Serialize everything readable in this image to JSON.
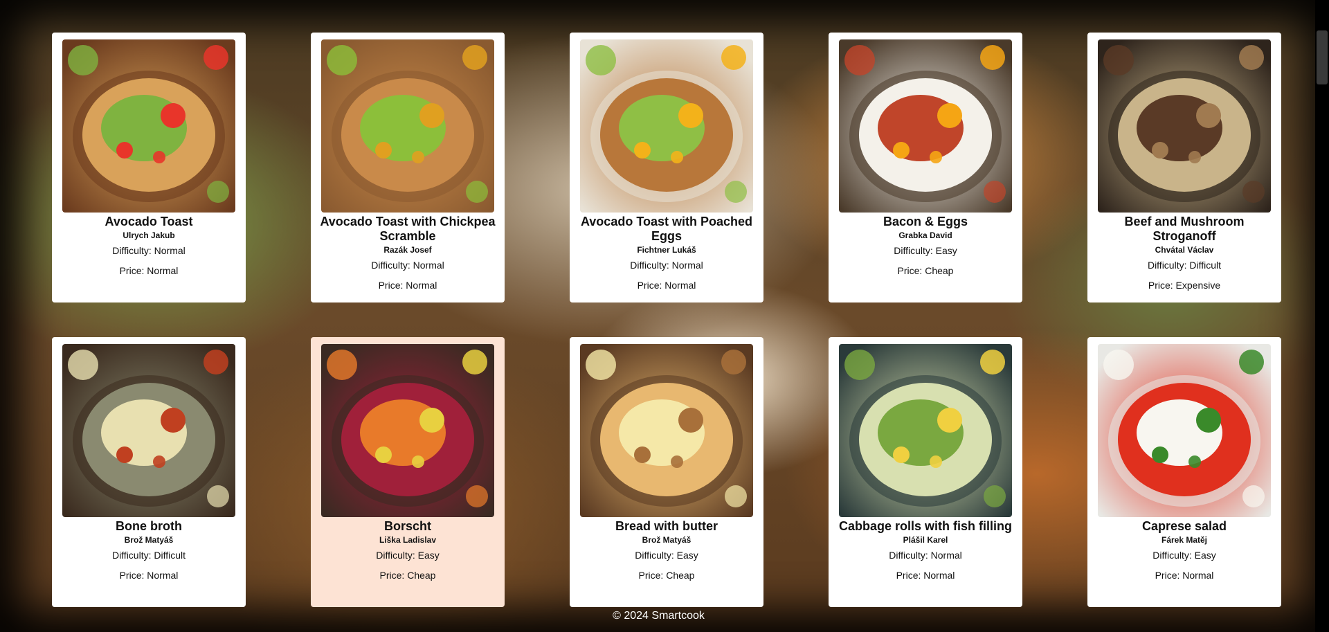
{
  "footer": {
    "copyright": "© 2024 Smartcook"
  },
  "labels": {
    "difficulty_prefix": "Difficulty: ",
    "price_prefix": "Price: "
  },
  "recipes": [
    {
      "title": "Avocado Toast",
      "author": "Ulrych Jakub",
      "difficulty": "Difficulty: Normal",
      "price": "Price: Normal",
      "image": "avocado-toast-image",
      "palette": [
        "#6b3b1e",
        "#d9a25a",
        "#7fb340",
        "#e8352a"
      ]
    },
    {
      "title": "Avocado Toast with Chickpea Scramble",
      "author": "Razák Josef",
      "difficulty": "Difficulty: Normal",
      "price": "Price: Normal",
      "image": "avocado-toast-chickpea-image",
      "palette": [
        "#8a5a30",
        "#c98a4a",
        "#8cbf3a",
        "#e0a020"
      ]
    },
    {
      "title": "Avocado Toast with Poached Eggs",
      "author": "Fichtner Lukáš",
      "difficulty": "Difficulty: Normal",
      "price": "Price: Normal",
      "image": "avocado-toast-poached-eggs-image",
      "palette": [
        "#e8e2d6",
        "#b8773a",
        "#8fbf45",
        "#f3b21a"
      ]
    },
    {
      "title": "Bacon & Eggs",
      "author": "Grabka David",
      "difficulty": "Difficulty: Easy",
      "price": "Price: Cheap",
      "image": "bacon-and-eggs-image",
      "palette": [
        "#4a3a2a",
        "#f4f1ea",
        "#c0452a",
        "#f5a514"
      ]
    },
    {
      "title": "Beef and Mushroom Stroganoff",
      "author": "Chvátal Václav",
      "difficulty": "Difficulty: Difficult",
      "price": "Price: Expensive",
      "image": "beef-stroganoff-image",
      "palette": [
        "#2e241c",
        "#c9b48a",
        "#5a3a26",
        "#a07a50"
      ]
    },
    {
      "title": "Bone broth",
      "author": "Brož Matyáš",
      "difficulty": "Difficulty: Difficult",
      "price": "Price: Normal",
      "image": "bone-broth-image",
      "palette": [
        "#3a2a1e",
        "#8a8a70",
        "#e8e0b0",
        "#c04020"
      ]
    },
    {
      "title": "Borscht",
      "author": "Liška Ladislav",
      "difficulty": "Difficulty: Easy",
      "price": "Price: Cheap",
      "image": "borscht-image",
      "palette": [
        "#3a2a22",
        "#a0203a",
        "#e87a2a",
        "#e8d040"
      ]
    },
    {
      "title": "Bread with butter",
      "author": "Brož Matyáš",
      "difficulty": "Difficulty: Easy",
      "price": "Price: Cheap",
      "image": "bread-with-butter-image",
      "palette": [
        "#5a3a22",
        "#e8b870",
        "#f5e8a8",
        "#a8703a"
      ]
    },
    {
      "title": "Cabbage rolls with fish filling",
      "author": "Plášil Karel",
      "difficulty": "Difficulty: Normal",
      "price": "Price: Normal",
      "image": "cabbage-rolls-image",
      "palette": [
        "#2a3a3a",
        "#d8e0b0",
        "#7aa840",
        "#f0d040"
      ]
    },
    {
      "title": "Caprese salad",
      "author": "Fárek Matěj",
      "difficulty": "Difficulty: Easy",
      "price": "Price: Normal",
      "image": "caprese-salad-image",
      "palette": [
        "#e8e8e4",
        "#e0301e",
        "#f8f6f0",
        "#3a8a2a"
      ]
    }
  ]
}
